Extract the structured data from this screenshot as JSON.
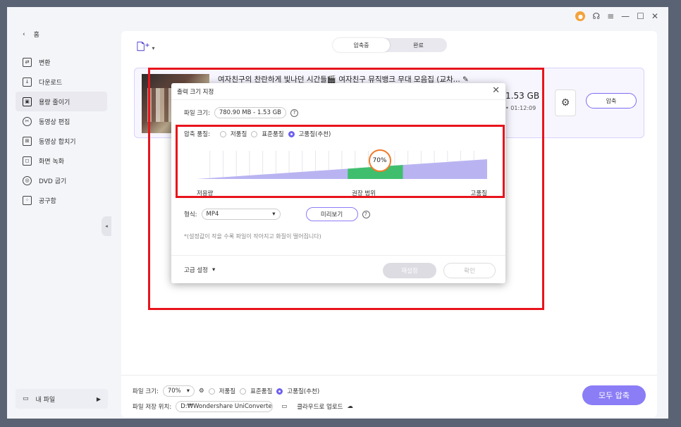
{
  "sidebar": {
    "home_label": "홈",
    "items": [
      {
        "label": "변환",
        "icon": "convert-icon"
      },
      {
        "label": "다운로드",
        "icon": "download-icon"
      },
      {
        "label": "용량 줄이기",
        "icon": "compress-icon",
        "active": true
      },
      {
        "label": "동영상 편집",
        "icon": "scissors-icon"
      },
      {
        "label": "동영상 합치기",
        "icon": "merge-icon"
      },
      {
        "label": "화면 녹화",
        "icon": "screen-record-icon"
      },
      {
        "label": "DVD 굽기",
        "icon": "disc-icon"
      },
      {
        "label": "공구함",
        "icon": "toolbox-icon"
      }
    ],
    "my_files": "내 파일"
  },
  "tabs": [
    {
      "label": "압축중",
      "active": true
    },
    {
      "label": "완료",
      "active": false
    }
  ],
  "file": {
    "title": "여자친구의 찬란하게 빛나던 시간들🎬 여자친구 뮤직뱅크 무대 모음집 (교차...",
    "size": "1.53 GB",
    "duration": "01:12:09",
    "compress_label": "압축"
  },
  "dialog": {
    "title": "출력 크기 지정",
    "file_size_label": "파일 크기:",
    "file_size_value": "780.90 MB - 1.53 GB",
    "quality_label": "압축 품질:",
    "quality_options": [
      "저품질",
      "표준품질",
      "고품질(추천)"
    ],
    "quality_selected": 2,
    "slider_value": "70%",
    "slider_level": 0.7,
    "slider_labels": [
      "저용량",
      "권장 범위",
      "고품질"
    ],
    "format_label": "형식:",
    "format_value": "MP4",
    "preview_label": "미리보기",
    "note": "*(설정값이 작을 수록 파일이 작아지고 화질이 떨어집니다)",
    "advanced_label": "고급 설정",
    "reset_label": "재설정",
    "ok_label": "확인"
  },
  "bottom": {
    "file_size_label": "파일 크기:",
    "file_size_value": "70%",
    "quality_options": [
      "저품질",
      "표준품질",
      "고품질(추천)"
    ],
    "path_label": "파일 저장 위치:",
    "path_value": "D:₩Wondershare UniConverte",
    "cloud_label": "클라우드로 업로드",
    "compress_all": "모두 압축"
  },
  "colors": {
    "accent": "#8b7df6",
    "highlight": "#e8141c",
    "slider_fill": "#b9b4f1",
    "recommended": "#3fbf6e",
    "badge_ring": "#f07b2a"
  }
}
